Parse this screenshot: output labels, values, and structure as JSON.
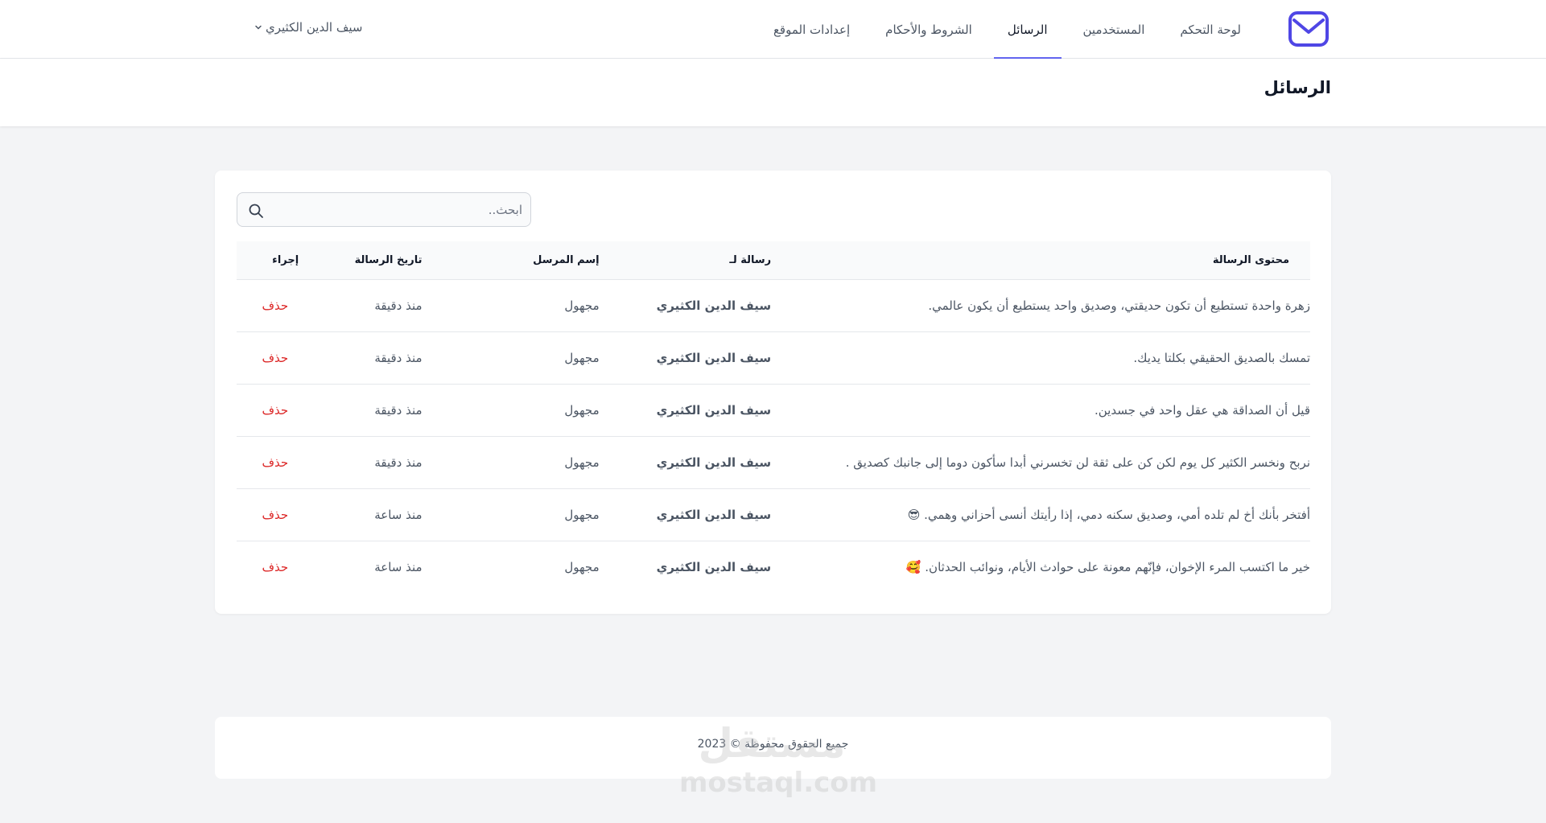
{
  "nav": {
    "links": [
      {
        "label": "لوحة التحكم"
      },
      {
        "label": "المستخدمين"
      },
      {
        "label": "الرسائل",
        "active": true
      },
      {
        "label": "الشروط والأحكام"
      },
      {
        "label": "إعدادات الموقع"
      }
    ],
    "user_name": "سيف الدين الكثيري"
  },
  "page": {
    "title": "الرسائل"
  },
  "search": {
    "placeholder": "ابحث.."
  },
  "table": {
    "headers": {
      "content": "محتوى الرسالة",
      "to": "رسالة لـ",
      "sender": "إسم المرسل",
      "date": "تاريخ الرسالة",
      "action": "إجراء"
    },
    "rows": [
      {
        "content": "زهرة واحدة تستطيع أن تكون حديقتي، وصديق واحد يستطيع أن يكون عالمي.",
        "to": "سيف الدين الكثيري",
        "sender": "مجهول",
        "date": "منذ دقيقة",
        "action": "حذف"
      },
      {
        "content": "تمسك بالصديق الحقيقي بكلتا يديك.",
        "to": "سيف الدين الكثيري",
        "sender": "مجهول",
        "date": "منذ دقيقة",
        "action": "حذف"
      },
      {
        "content": "قيل أن الصداقة هي عقل واحد في جسدين.",
        "to": "سيف الدين الكثيري",
        "sender": "مجهول",
        "date": "منذ دقيقة",
        "action": "حذف"
      },
      {
        "content": "نربح ونخسر الكثير كل يوم لكن كن على ثقة لن تخسرني أبدا سأكون دوما إلى جانبك كصديق .",
        "to": "سيف الدين الكثيري",
        "sender": "مجهول",
        "date": "منذ دقيقة",
        "action": "حذف"
      },
      {
        "content": "أفتخر بأنك أخ لم تلده أمي، وصديق سكنه دمي، إذا رأيتك أنسى أحزاني وهمي. 😎",
        "to": "سيف الدين الكثيري",
        "sender": "مجهول",
        "date": "منذ ساعة",
        "action": "حذف"
      },
      {
        "content": "خير ما اكتسب المرء الإخوان، فإنّهم معونة على حوادث الأيام، ونوائب الحدثان. 🥰",
        "to": "سيف الدين الكثيري",
        "sender": "مجهول",
        "date": "منذ ساعة",
        "action": "حذف"
      }
    ]
  },
  "footer": {
    "copyright": "جميع الحقوق محفوظة © 2023",
    "watermark_ar": "مستقل",
    "watermark_en": "mostaql.com"
  },
  "colors": {
    "accent": "#6366f1",
    "danger": "#dc2626",
    "logo": "#4f46e5",
    "background": "#f3f4f6"
  }
}
